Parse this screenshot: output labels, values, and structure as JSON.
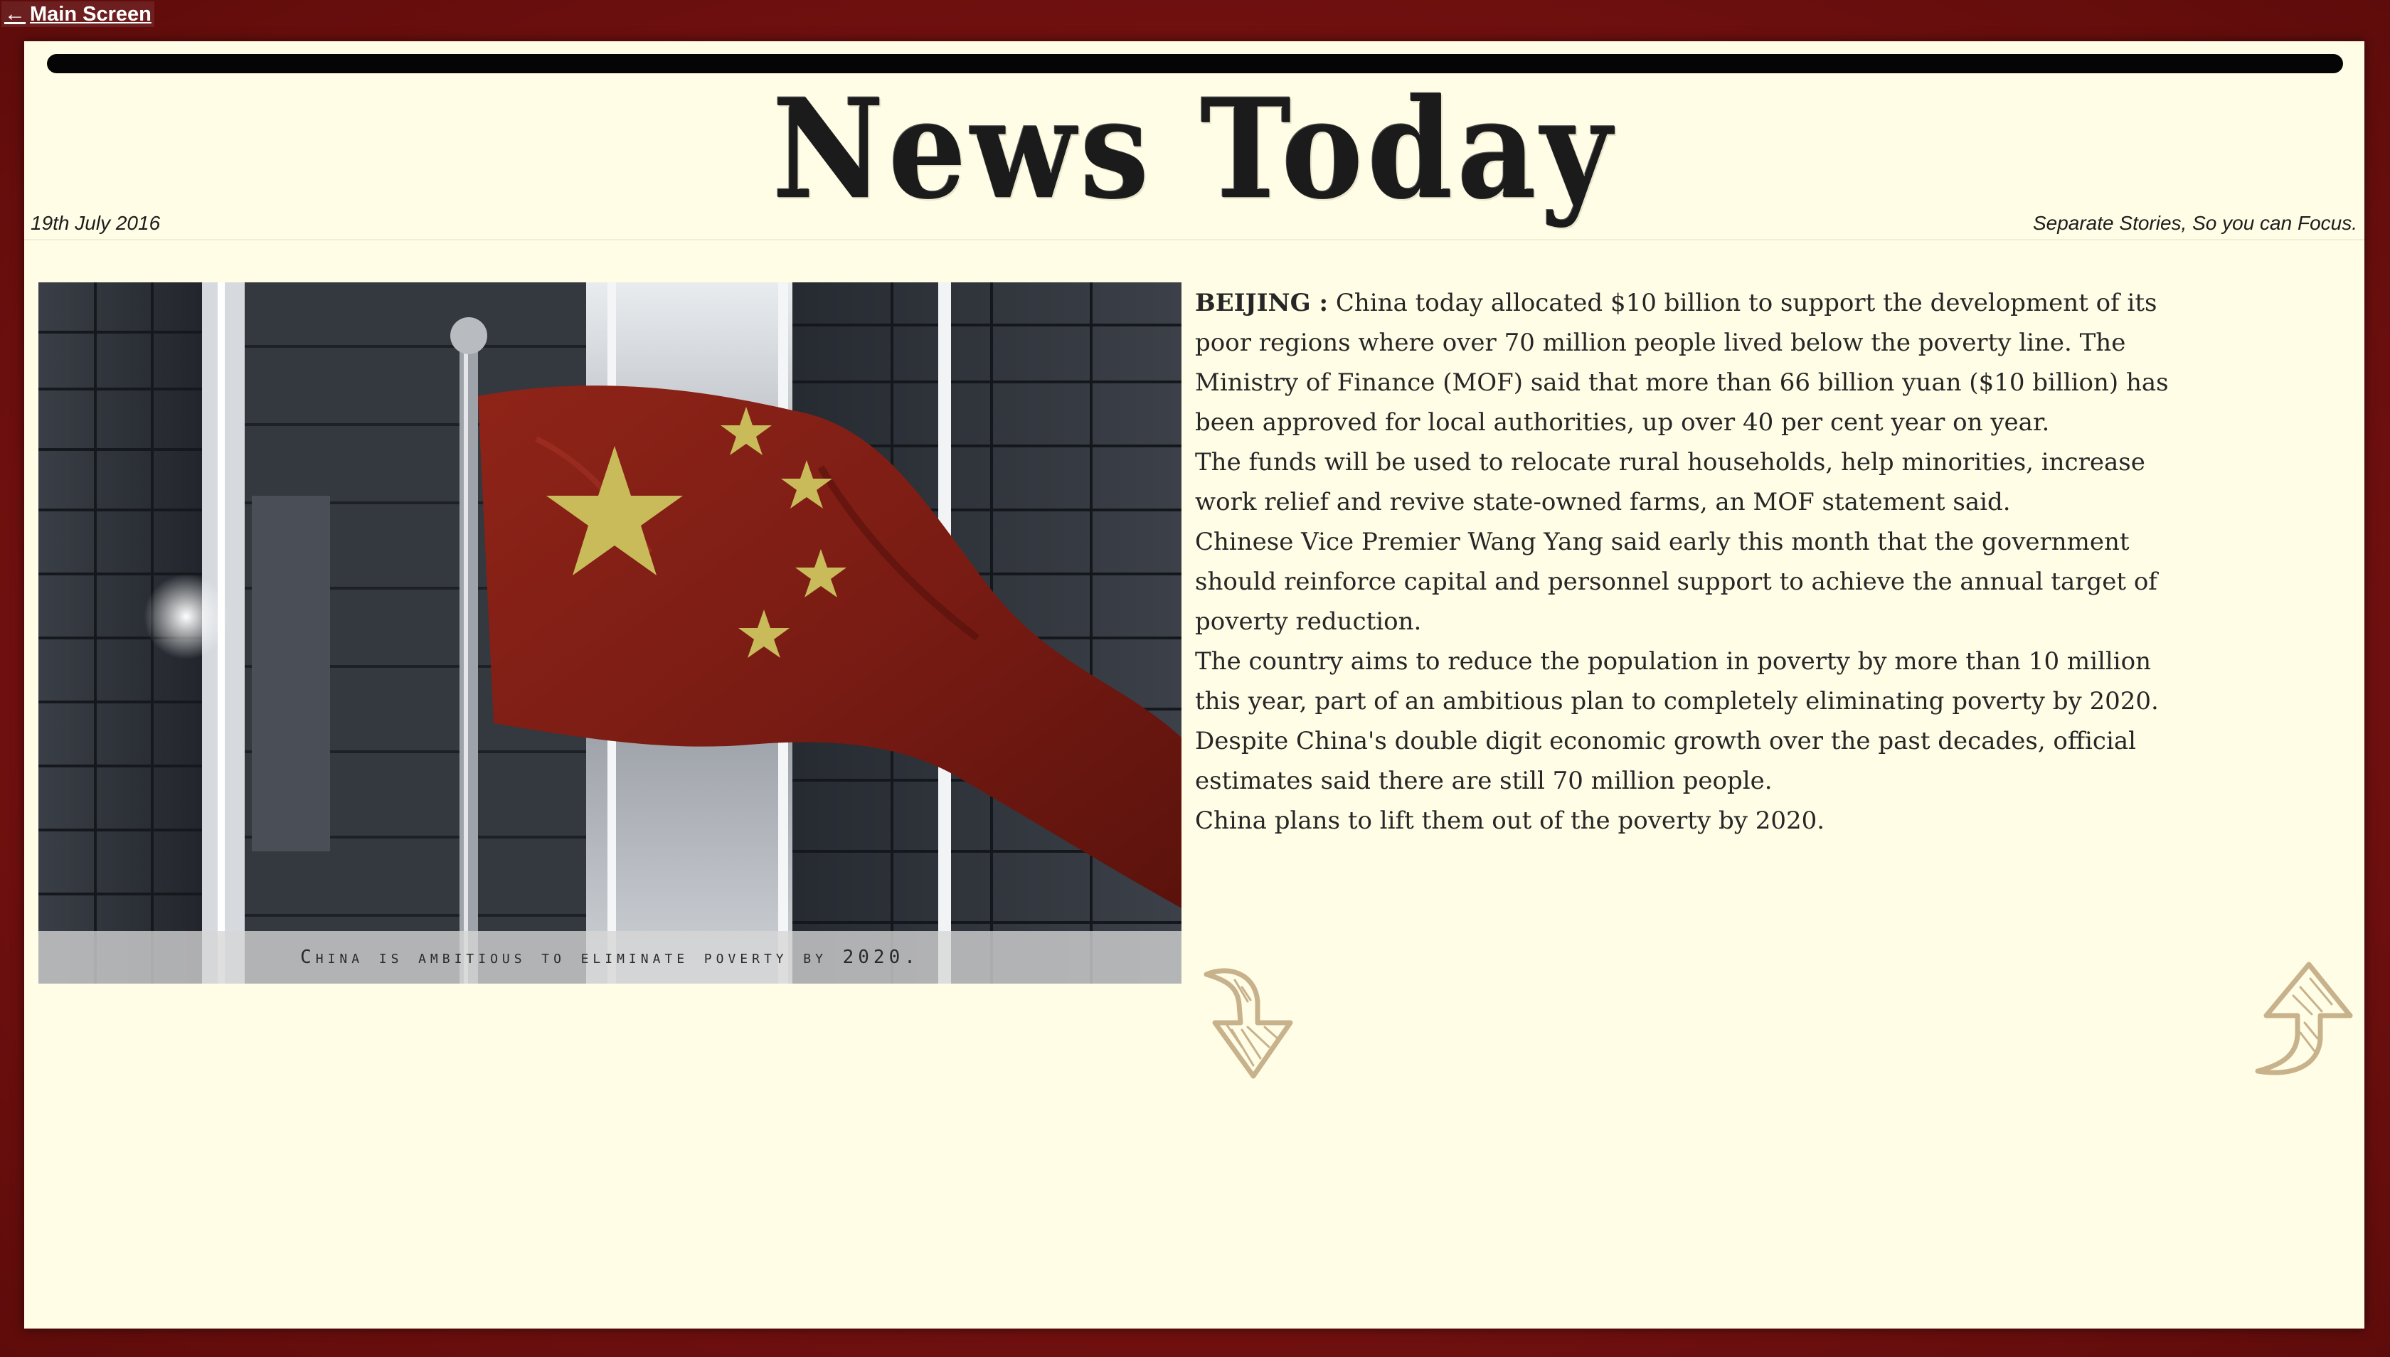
{
  "nav": {
    "back_label": "Main Screen"
  },
  "masthead": {
    "title": "News Today",
    "date": "19th July 2016",
    "tagline": "Separate Stories, So you can Focus."
  },
  "story": {
    "photo_caption": "China is ambitious to eliminate poverty by 2020.",
    "dateline_city": "BEIJING :",
    "lead": " China today allocated $10 billion to support the development of its poor regions where over 70 million people lived below the poverty line. The Ministry of Finance (MOF) said that more than 66 billion yuan ($10 billion) has been approved for local authorities, up over 40 per cent year on year.",
    "paragraphs": [
      "The funds will be used to relocate rural households, help minorities, increase work relief and revive state-owned farms, an MOF statement said.",
      "Chinese Vice Premier Wang Yang said early this month that the government should reinforce capital and personnel support to achieve the annual target of poverty reduction.",
      "The country aims to reduce the population in poverty by more than 10 million this year, part of an ambitious plan to completely eliminating poverty by 2020.",
      "Despite China's double digit economic growth over the past decades, official estimates said there are still 70 million people.",
      "China plans to lift them out of the poverty by 2020."
    ]
  },
  "icons": {
    "back": "arrow-left-icon",
    "next": "curved-arrow-down-icon",
    "prev": "curved-arrow-up-icon"
  },
  "colors": {
    "frame": "#7a1210",
    "paper": "#fffde6",
    "ink": "#262626",
    "arrow": "#c8b28c"
  }
}
